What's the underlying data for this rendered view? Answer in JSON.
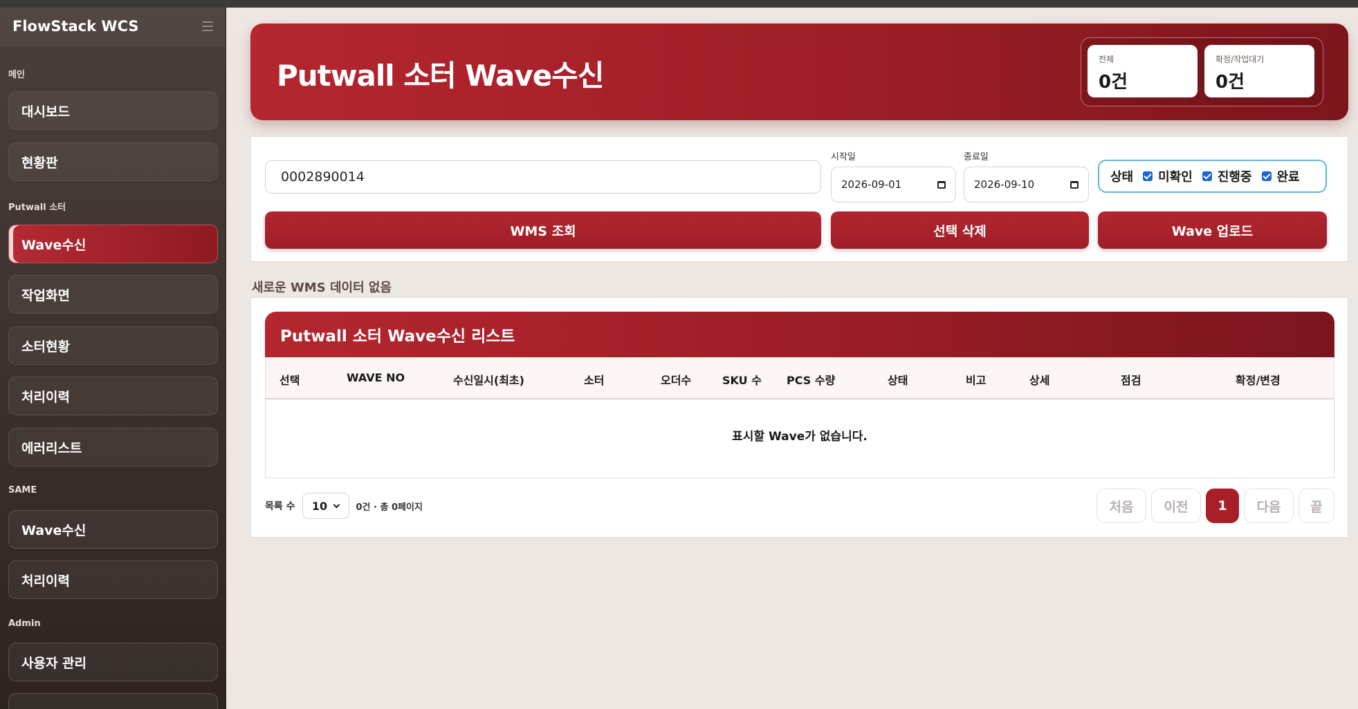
{
  "app": {
    "title": "FlowStack WCS"
  },
  "sidebar": {
    "sections": [
      {
        "label": "메인"
      },
      {
        "label": "Putwall 소터"
      },
      {
        "label": "SAME"
      },
      {
        "label": "Admin"
      }
    ],
    "items": [
      {
        "label": "대시보드"
      },
      {
        "label": "현황판"
      },
      {
        "label": "Wave수신",
        "active": true
      },
      {
        "label": "작업화면"
      },
      {
        "label": "소터현황"
      },
      {
        "label": "처리이력"
      },
      {
        "label": "에러리스트"
      },
      {
        "label": "Wave수신"
      },
      {
        "label": "처리이력"
      },
      {
        "label": "사용자 관리"
      }
    ]
  },
  "header": {
    "title": "Putwall 소터 Wave수신",
    "stats": [
      {
        "label": "전체",
        "value": "0건"
      },
      {
        "label": "확정/작업대기",
        "value": "0건"
      }
    ]
  },
  "filters": {
    "search_value": "0002890014",
    "start_label": "시작일",
    "start_value": "2026-09-01",
    "end_label": "종료일",
    "end_value": "2026-09-10",
    "status_label": "상태",
    "status_options": [
      {
        "label": "미확인",
        "checked": true
      },
      {
        "label": "진행중",
        "checked": true
      },
      {
        "label": "완료",
        "checked": true
      }
    ],
    "buttons": {
      "wms": "WMS 조회",
      "delete": "선택 삭제",
      "upload": "Wave 업로드"
    }
  },
  "notice": "새로운 WMS 데이터 없음",
  "list": {
    "title": "Putwall 소터 Wave수신 리스트",
    "columns": [
      "선택",
      "WAVE NO",
      "수신일시(최초)",
      "소터",
      "오더수",
      "SKU 수",
      "PCS 수량",
      "상태",
      "비고",
      "상세",
      "점검",
      "확정/변경"
    ],
    "empty_message": "표시할 Wave가 없습니다.",
    "page_size_label": "목록 수",
    "page_size": "10",
    "summary": "0건 · 총 0페이지",
    "pager": {
      "first": "처음",
      "prev": "이전",
      "current": "1",
      "next": "다음",
      "last": "끝"
    }
  },
  "colors": {
    "accent": "#a81f29",
    "sidebar": "#3b302c",
    "focus": "#5bb4e8"
  }
}
